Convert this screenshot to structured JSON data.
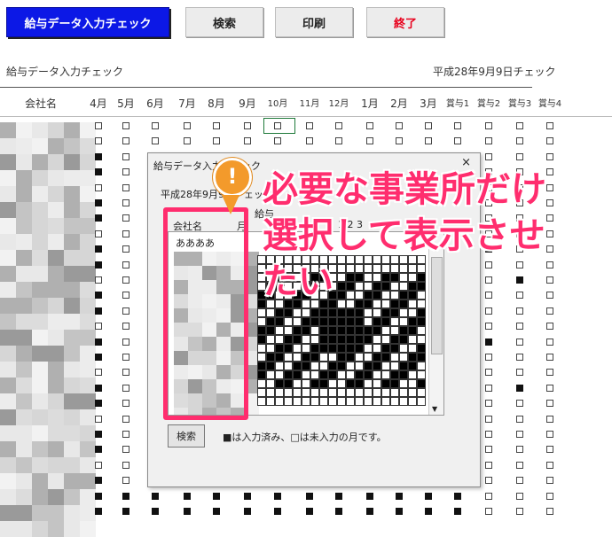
{
  "toolbar": {
    "title": "給与データ入力チェック",
    "search": "検索",
    "print": "印刷",
    "close": "終了",
    "close_color": "#e8001c",
    "title_bg": "#0c18e6"
  },
  "sheet": {
    "heading": "給与データ入力チェック",
    "check_date": "平成28年9月9日チェック",
    "company_header": "会社名",
    "months": [
      "4月",
      "5月",
      "6月",
      "7月",
      "8月",
      "9月",
      "10月",
      "11月",
      "12月",
      "1月",
      "2月",
      "3月",
      "賞与1",
      "賞与2",
      "賞与3",
      "賞与4"
    ]
  },
  "dialog": {
    "title": "給与データ入力チェック",
    "close_symbol": "×",
    "date_text": "平成28年9月9日チェック",
    "salary_label": "給与",
    "company_header": "会社名",
    "month_header": "月",
    "month_numbers": "1  2  3",
    "first_company": "ああああ",
    "search_button": "検索",
    "legend": "■は入力済み、□は未入力の月です。"
  },
  "annotation": {
    "badge": "!",
    "line1": "必要な事業所だけ",
    "line2": "選択して表示させ",
    "line3": "たい",
    "color": "#ff2d6e",
    "badge_color": "#f39a2b"
  }
}
